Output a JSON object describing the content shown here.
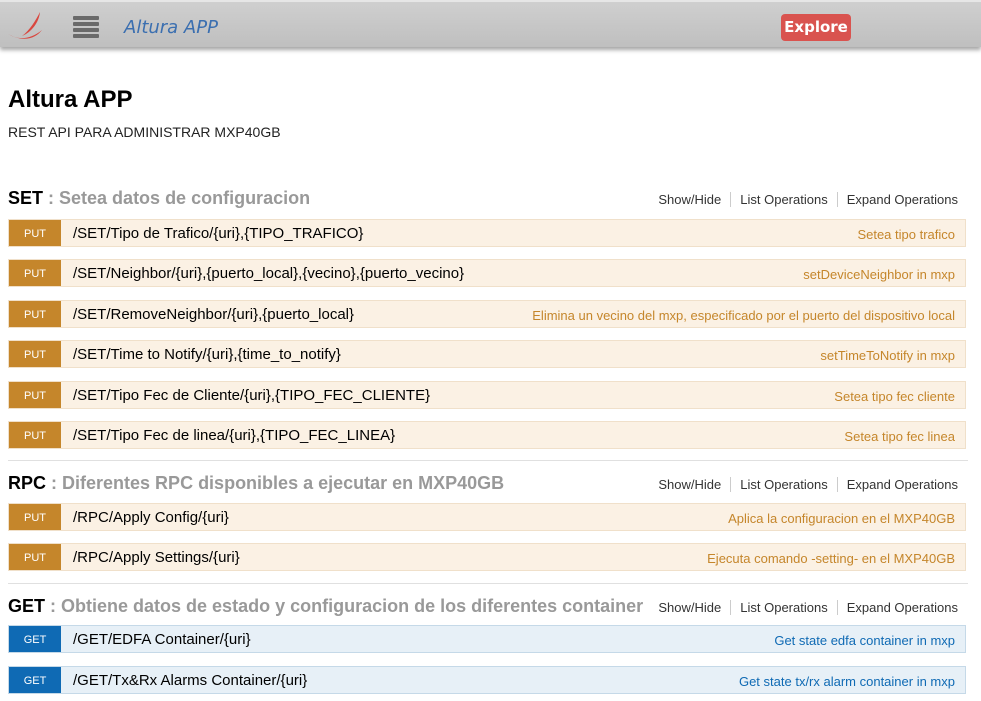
{
  "header": {
    "app_title": "Altura APP",
    "explore_label": "Explore",
    "logo_icon": "altura-swoosh-logo",
    "menu_icon": "hamburger-menu-icon"
  },
  "info": {
    "title": "Altura APP",
    "description": "REST API PARA ADMINISTRAR MXP40GB"
  },
  "ops_labels": {
    "show_hide": "Show/Hide",
    "list_operations": "List Operations",
    "expand_operations": "Expand Operations"
  },
  "sections": [
    {
      "name": "SET",
      "description": ": Setea datos de configuracion",
      "operations": [
        {
          "method": "PUT",
          "path": "/SET/Tipo de Trafico/{uri},{TIPO_TRAFICO}",
          "summary": "Setea tipo trafico"
        },
        {
          "method": "PUT",
          "path": "/SET/Neighbor/{uri},{puerto_local},{vecino},{puerto_vecino}",
          "summary": "setDeviceNeighbor in mxp"
        },
        {
          "method": "PUT",
          "path": "/SET/RemoveNeighbor/{uri},{puerto_local}",
          "summary": "Elimina un vecino del mxp, especificado por el puerto del dispositivo local"
        },
        {
          "method": "PUT",
          "path": "/SET/Time to Notify/{uri},{time_to_notify}",
          "summary": "setTimeToNotify in mxp"
        },
        {
          "method": "PUT",
          "path": "/SET/Tipo Fec de Cliente/{uri},{TIPO_FEC_CLIENTE}",
          "summary": "Setea tipo fec cliente"
        },
        {
          "method": "PUT",
          "path": "/SET/Tipo Fec de linea/{uri},{TIPO_FEC_LINEA}",
          "summary": "Setea tipo fec linea"
        }
      ]
    },
    {
      "name": "RPC",
      "description": ": Diferentes RPC disponibles a ejecutar en MXP40GB",
      "operations": [
        {
          "method": "PUT",
          "path": "/RPC/Apply Config/{uri}",
          "summary": "Aplica la configuracion en el MXP40GB"
        },
        {
          "method": "PUT",
          "path": "/RPC/Apply Settings/{uri}",
          "summary": "Ejecuta comando -setting- en el MXP40GB"
        }
      ]
    },
    {
      "name": "GET",
      "description": ": Obtiene datos de estado y configuracion de los diferentes container",
      "operations": [
        {
          "method": "GET",
          "path": "/GET/EDFA Container/{uri}",
          "summary": "Get state edfa container in mxp"
        },
        {
          "method": "GET",
          "path": "/GET/Tx&Rx Alarms Container/{uri}",
          "summary": "Get state tx/rx alarm container in mxp"
        }
      ]
    }
  ],
  "colors": {
    "put": "#c5862b",
    "put_bg": "#fbf1e4",
    "get": "#0f6ab4",
    "get_bg": "#e7f0f7",
    "explore": "#d9534f",
    "title_link": "#3b6fb0"
  }
}
